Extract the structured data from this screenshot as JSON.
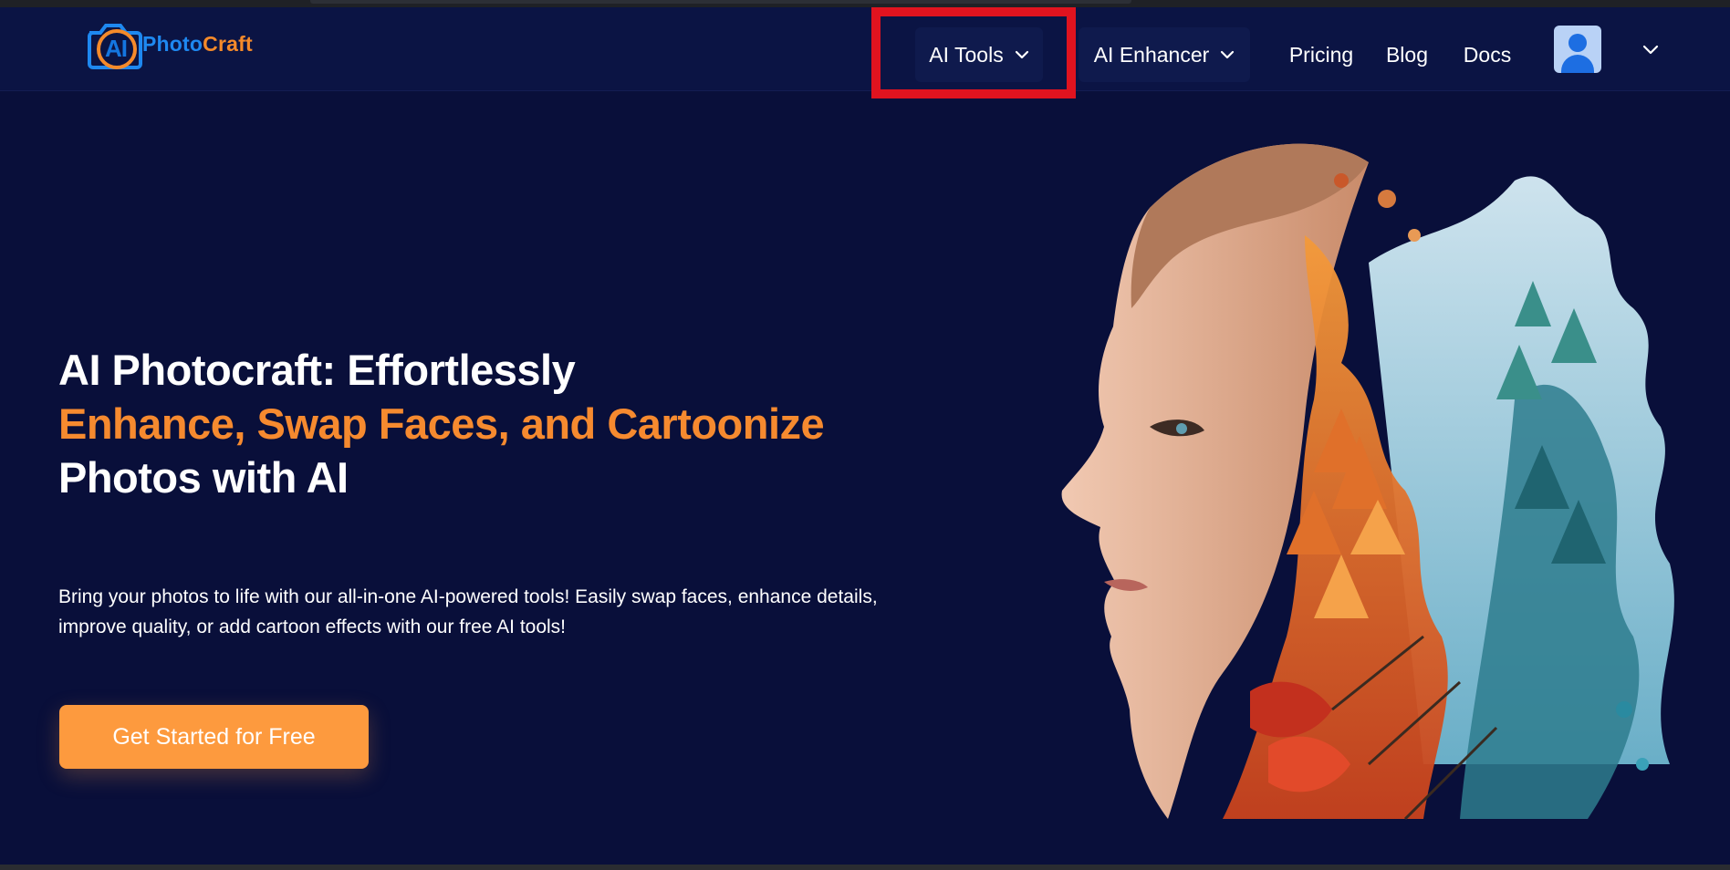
{
  "brand": {
    "logo_mark": "AI",
    "name_part1": "Photo",
    "name_part2": "Craft"
  },
  "nav": {
    "ai_tools": "AI Tools",
    "ai_enhancer": "AI Enhancer",
    "pricing": "Pricing",
    "blog": "Blog",
    "docs": "Docs"
  },
  "hero": {
    "title_line1": "AI Photocraft: Effortlessly",
    "title_line2": "Enhance, Swap Faces, and Cartoonize",
    "title_line3": "Photos with AI",
    "description_line1": "Bring your photos to life with our all-in-one AI-powered tools! Easily swap faces, enhance details,",
    "description_line2": "improve quality, or add cartoon effects with our free AI tools!",
    "cta_label": "Get Started for Free"
  },
  "colors": {
    "page_bg": "#090f3a",
    "header_bg": "#0b1444",
    "accent_orange": "#f68a2f",
    "cta_bg": "#fd9a3e",
    "highlight_red": "#e0131f",
    "logo_blue": "#1e88f0"
  },
  "icons": {
    "dropdown": "chevron-down-icon",
    "user": "user-avatar-icon"
  }
}
